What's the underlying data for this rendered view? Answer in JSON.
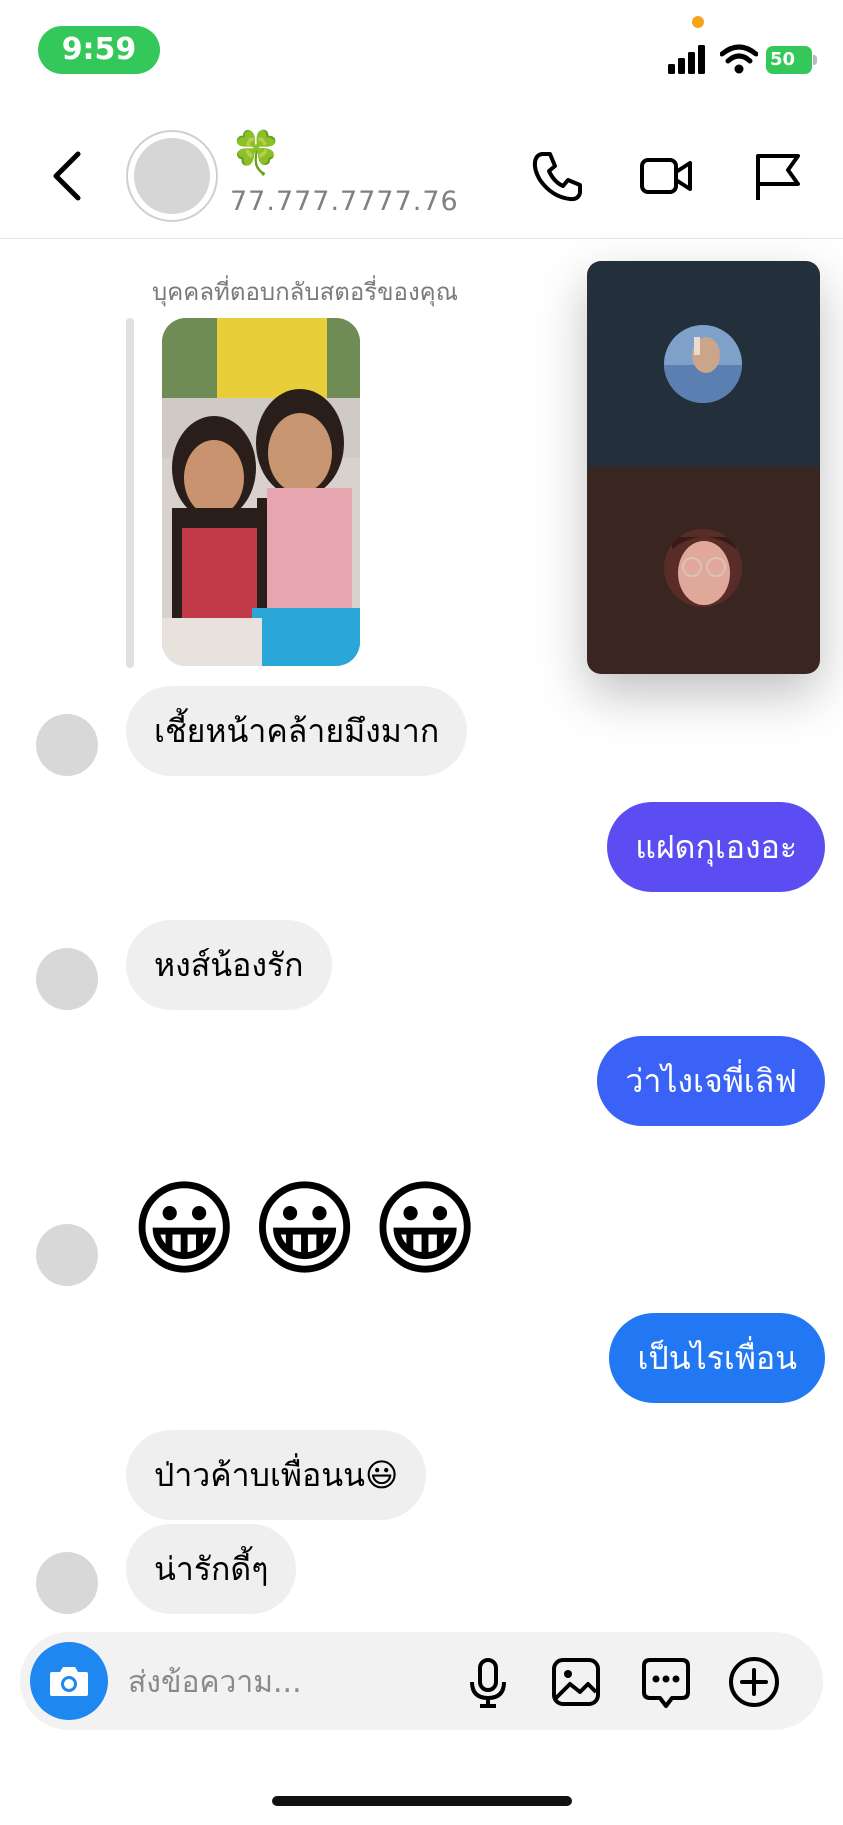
{
  "status_bar": {
    "time": "9:59",
    "battery": "50"
  },
  "header": {
    "emoji": "🍀",
    "contact_name": "77.777.7777.76"
  },
  "story_reply": {
    "caption": "บุคคลที่ตอบกลับสตอรี่ของคุณ"
  },
  "messages": [
    {
      "side": "in",
      "text": "เชี้ยหน้าคล้ายมึงมาก"
    },
    {
      "side": "out",
      "text": "แฝดกุเองอะ",
      "color": "#5b4df2"
    },
    {
      "side": "in",
      "text": "หงส์น้องรัก"
    },
    {
      "side": "out",
      "text": "ว่าไงเจพี่เลิฟ",
      "color": "#3a62f7"
    },
    {
      "side": "in",
      "text": "😀😀😀"
    },
    {
      "side": "out",
      "text": "เป็นไรเพื่อน",
      "color": "#2277f2"
    },
    {
      "side": "in",
      "text": "ป่าวค้าบเพื่อนน😃"
    },
    {
      "side": "in",
      "text": "น่ารักดี้ๆ"
    }
  ],
  "composer": {
    "placeholder": "ส่งข้อความ..."
  },
  "colors": {
    "accent_blue": "#1e88f0",
    "status_green": "#34c759"
  },
  "icons": [
    "back-icon",
    "phone-icon",
    "video-camera-icon",
    "flag-icon",
    "camera-icon",
    "microphone-icon",
    "image-icon",
    "sticker-icon",
    "plus-icon"
  ]
}
